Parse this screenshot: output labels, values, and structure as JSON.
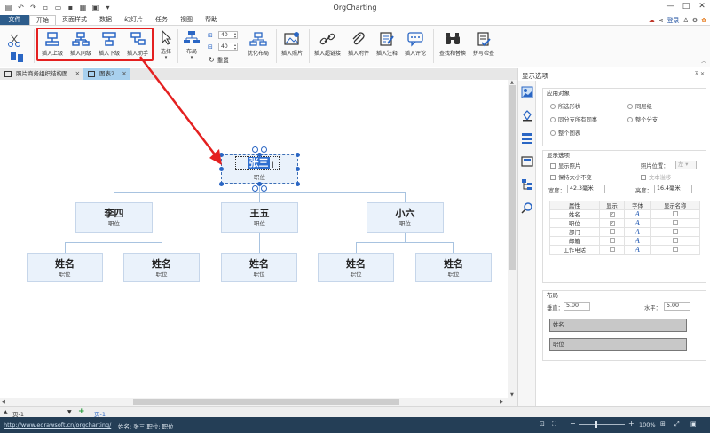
{
  "app": {
    "title": "OrgCharting",
    "login": "登录"
  },
  "menu": {
    "file": "文件",
    "items": [
      "开始",
      "页面样式",
      "数据",
      "幻灯片",
      "任务",
      "视图",
      "帮助"
    ]
  },
  "ribbon": {
    "insert_superior": "插入上级",
    "insert_peer": "插入同级",
    "insert_subordinate": "插入下级",
    "insert_assistant": "插入助手",
    "select": "选择",
    "layout": "布局",
    "spacing_1": "40",
    "spacing_2": "40",
    "reset": "重置",
    "optimize_layout": "优化布局",
    "insert_photo": "插入照片",
    "insert_hyperlink": "插入超链接",
    "insert_attachment": "插入附件",
    "insert_note": "插入注释",
    "insert_comment": "插入评论",
    "find_replace": "查找和替换",
    "spell_check": "拼写检查"
  },
  "doc_tabs": [
    {
      "label": "照片商务组织结构图",
      "active": false
    },
    {
      "label": "图表2",
      "active": true
    }
  ],
  "chart": {
    "root": {
      "name": "张三",
      "position": "职位"
    },
    "level1": [
      {
        "name": "李四",
        "position": "职位"
      },
      {
        "name": "王五",
        "position": "职位"
      },
      {
        "name": "小六",
        "position": "职位"
      }
    ],
    "level2": [
      {
        "name": "姓名",
        "position": "职位"
      },
      {
        "name": "姓名",
        "position": "职位"
      },
      {
        "name": "姓名",
        "position": "职位"
      },
      {
        "name": "姓名",
        "position": "职位"
      },
      {
        "name": "姓名",
        "position": "职位"
      }
    ]
  },
  "panel": {
    "title": "显示选项",
    "apply_to": {
      "title": "应用对象",
      "options": [
        "所选形状",
        "同层级",
        "同分支所有同事",
        "整个分支",
        "整个图表"
      ]
    },
    "display": {
      "title": "显示选项",
      "show_photo": "显示照片",
      "photo_position_label": "照片位置：",
      "photo_position_value": "左",
      "keep_size": "保持大小不变",
      "text_wrap": "文本溢移",
      "width_label": "宽度：",
      "width_value": "42.3毫米",
      "height_label": "高度：",
      "height_value": "16.4毫米",
      "table_headers": [
        "属性",
        "显示",
        "字体",
        "显示名称"
      ],
      "rows": [
        {
          "attr": "姓名",
          "show": "✓",
          "font": "A"
        },
        {
          "attr": "职位",
          "show": "✓",
          "font": "A"
        },
        {
          "attr": "部门",
          "show": "",
          "font": "A"
        },
        {
          "attr": "邮箱",
          "show": "",
          "font": "A"
        },
        {
          "attr": "工作电话",
          "show": "",
          "font": "A"
        }
      ]
    },
    "layout": {
      "title": "布局",
      "vertical_label": "垂直：",
      "vertical_value": "5.00",
      "horizontal_label": "水平：",
      "horizontal_value": "5.00",
      "box1": "姓名",
      "box2": "职位"
    }
  },
  "pages": {
    "current": "页-1",
    "tab": "页-1",
    "add": "+"
  },
  "status": {
    "url": "http://www.edrawsoft.cn/orgcharting/",
    "shape": "姓名: 张三   职位: 职位",
    "zoom": "100%"
  },
  "colors": {
    "accent": "#2d5c8b",
    "highlight_box": "#e42020",
    "status_bg": "#243e56"
  }
}
